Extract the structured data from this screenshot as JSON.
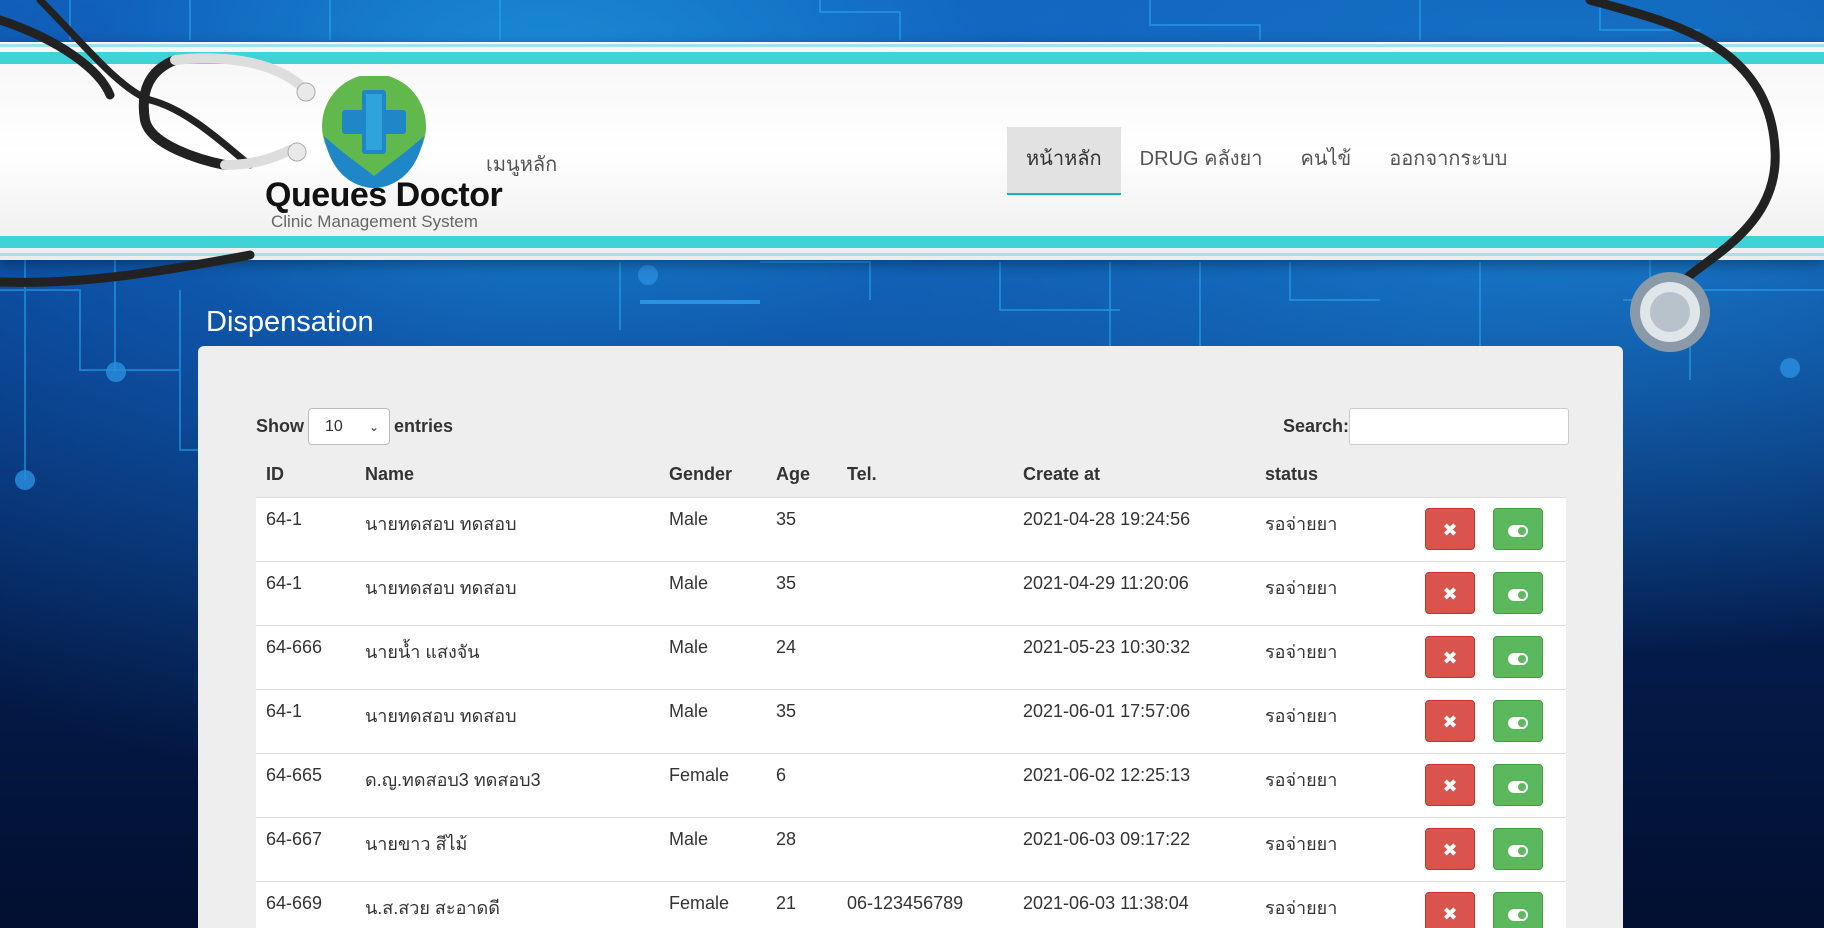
{
  "app": {
    "logo_title": "Queues Doctor",
    "logo_subtitle": "Clinic Management System",
    "main_menu_label": "เมนูหลัก"
  },
  "nav": {
    "items": [
      {
        "label": "หน้าหลัก",
        "active": true
      },
      {
        "label": "DRUG คลังยา",
        "active": false
      },
      {
        "label": "คนไข้",
        "active": false
      },
      {
        "label": "ออกจากระบบ",
        "active": false
      }
    ]
  },
  "page": {
    "title": "Dispensation"
  },
  "table_controls": {
    "show_label": "Show",
    "entries_value": "10",
    "entries_label": "entries",
    "search_label": "Search:",
    "search_value": ""
  },
  "table": {
    "columns": [
      "ID",
      "Name",
      "Gender",
      "Age",
      "Tel.",
      "Create at",
      "status",
      ""
    ],
    "rows": [
      {
        "id": "64-1",
        "name": "นายทดสอบ ทดสอบ",
        "gender": "Male",
        "age": "35",
        "tel": "",
        "created": "2021-04-28 19:24:56",
        "status": "รอจ่ายยา"
      },
      {
        "id": "64-1",
        "name": "นายทดสอบ ทดสอบ",
        "gender": "Male",
        "age": "35",
        "tel": "",
        "created": "2021-04-29 11:20:06",
        "status": "รอจ่ายยา"
      },
      {
        "id": "64-666",
        "name": "นายน้ำ แสงจัน",
        "gender": "Male",
        "age": "24",
        "tel": "",
        "created": "2021-05-23 10:30:32",
        "status": "รอจ่ายยา"
      },
      {
        "id": "64-1",
        "name": "นายทดสอบ ทดสอบ",
        "gender": "Male",
        "age": "35",
        "tel": "",
        "created": "2021-06-01 17:57:06",
        "status": "รอจ่ายยา"
      },
      {
        "id": "64-665",
        "name": "ด.ญ.ทดสอบ3 ทดสอบ3",
        "gender": "Female",
        "age": "6",
        "tel": "",
        "created": "2021-06-02 12:25:13",
        "status": "รอจ่ายยา"
      },
      {
        "id": "64-667",
        "name": "นายขาว สีไม้",
        "gender": "Male",
        "age": "28",
        "tel": "",
        "created": "2021-06-03 09:17:22",
        "status": "รอจ่ายยา"
      },
      {
        "id": "64-669",
        "name": "น.ส.สวย สะอาดดี",
        "gender": "Female",
        "age": "21",
        "tel": "06-123456789",
        "created": "2021-06-03 11:38:04",
        "status": "รอจ่ายยา"
      }
    ],
    "delete_icon": "close-icon",
    "toggle_icon": "toggle-on-icon"
  },
  "colors": {
    "accent_teal": "#3fd3d6",
    "danger": "#d9534f",
    "success": "#5cb85c"
  }
}
